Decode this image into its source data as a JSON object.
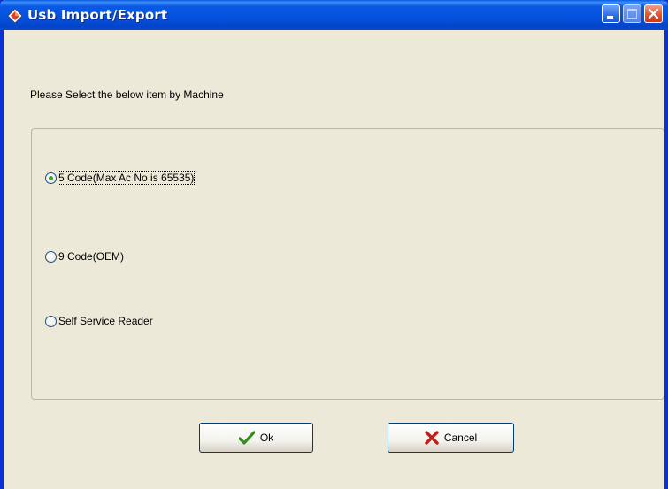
{
  "window": {
    "title": "Usb Import/Export",
    "icon": "diamond-app-icon",
    "controls": [
      "minimize-icon",
      "maximize-icon",
      "close-icon"
    ],
    "titlebar_color": "#0a5ae6"
  },
  "main": {
    "prompt": "Please Select the below item by Machine",
    "options": [
      {
        "label": "5 Code(Max Ac No is 65535)",
        "checked": true
      },
      {
        "label": "9 Code(OEM)",
        "checked": false
      },
      {
        "label": "Self Service Reader",
        "checked": false
      }
    ]
  },
  "buttons": {
    "ok_label": "Ok",
    "ok_icon": "checkmark-icon",
    "ok_icon_color": "#2f8f1a",
    "cancel_label": "Cancel",
    "cancel_icon": "cross-icon",
    "cancel_icon_color": "#c0201a"
  }
}
